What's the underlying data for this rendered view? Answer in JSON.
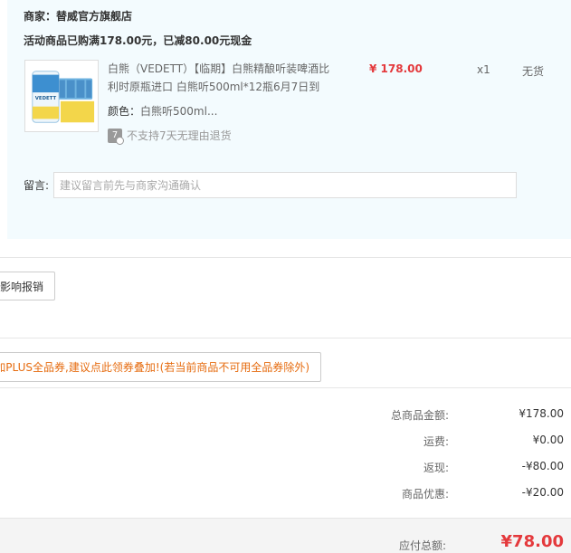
{
  "merchant": {
    "label": "商家：",
    "name": "替威官方旗舰店"
  },
  "promo": {
    "text": "活动商品已购满178.00元，已减80.00元现金"
  },
  "product": {
    "title": "白熊（VEDETT）【临期】白熊精酿听装啤酒比利时原瓶进口 白熊听500ml*12瓶6月7日到",
    "color_label": "颜色：",
    "color_value": "白熊听500ml...",
    "no_return_badge": "7",
    "no_return_text": "不支持7天无理由退货",
    "price": "¥ 178.00",
    "qty": "x1",
    "stock": "无货",
    "thumb_brand": "VEDETT"
  },
  "remark": {
    "label": "留言:",
    "placeholder": "建议留言前先与商家沟通确认"
  },
  "invoice": {
    "button_label": "影响报销"
  },
  "coupon": {
    "button_label": "加PLUS全品券,建议点此领券叠加!(若当前商品不可用全品券除外)"
  },
  "summary": {
    "rows": [
      {
        "label": "总商品金额:",
        "value": "¥178.00"
      },
      {
        "label": "运费:",
        "value": "¥0.00"
      },
      {
        "label": "返现:",
        "value": "-¥80.00"
      },
      {
        "label": "商品优惠:",
        "value": "-¥20.00"
      }
    ],
    "total_label": "应付总额:",
    "total_value": "¥78.00"
  },
  "colors": {
    "price_red": "#e4393c",
    "coupon_orange": "#e66c10",
    "block_bg": "#f3fbfe"
  }
}
